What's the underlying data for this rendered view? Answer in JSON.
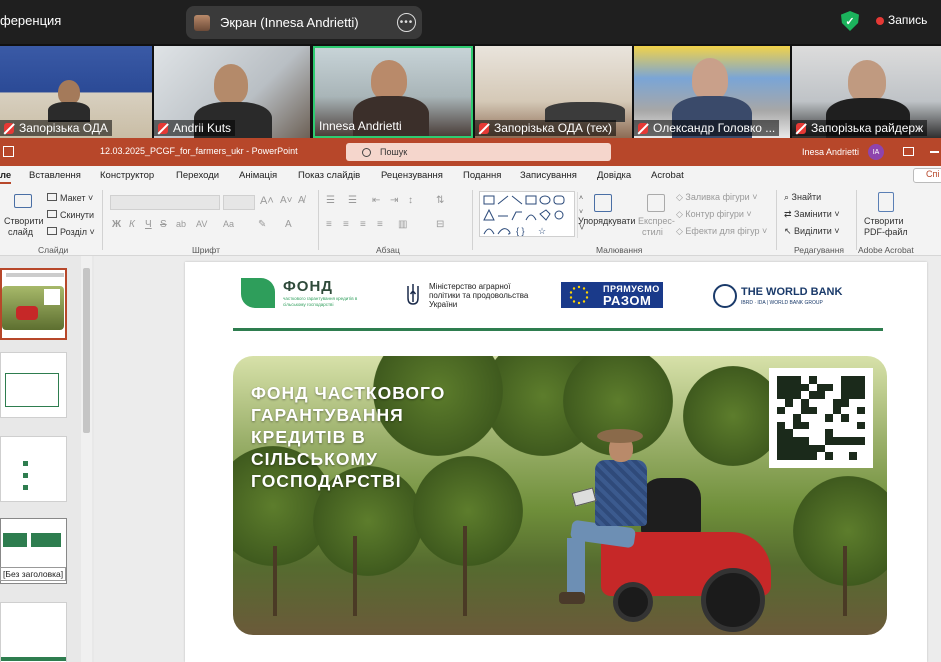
{
  "zoom": {
    "meeting_title": "ференция",
    "share_label": "Экран (Innesa Andrietti)",
    "record_label": "Запись"
  },
  "participants": [
    {
      "name": "Запорізька ОДА",
      "muted": true
    },
    {
      "name": "Andrii Kuts",
      "muted": true
    },
    {
      "name": "Innesa Andrietti",
      "muted": false
    },
    {
      "name": "Запорізька ОДА (тех)",
      "muted": true
    },
    {
      "name": "Олександр Головко ...",
      "muted": true
    },
    {
      "name": "Запорізька райдерж",
      "muted": true
    }
  ],
  "powerpoint": {
    "file_name": "12.03.2025_PCGF_for_farmers_ukr  -  PowerPoint",
    "search_placeholder": "Пошук",
    "user_name": "Inesa Andrietti",
    "user_initials": "IA",
    "tabs": [
      "ле",
      "Вставлення",
      "Конструктор",
      "Переходи",
      "Анімація",
      "Показ слайдів",
      "Рецензування",
      "Подання",
      "Записування",
      "Довідка",
      "Acrobat"
    ],
    "share_button": "Спі",
    "ribbon": {
      "new_slide": "Створити",
      "new_slide_2": "слайд",
      "layout": "Макет",
      "reset": "Скинути",
      "section": "Розділ",
      "group_slides": "Слайди",
      "group_font": "Шрифт",
      "group_paragraph": "Абзац",
      "arrange": "Упорядкувати",
      "quick_styles": "Експрес-",
      "quick_styles_2": "стилі",
      "shape_fill": "Заливка фігури",
      "shape_outline": "Контур фігури",
      "shape_effects": "Ефекти для фігур",
      "group_drawing": "Малювання",
      "find": "Знайти",
      "replace": "Замінити",
      "select": "Виділити",
      "group_editing": "Редагування",
      "create_pdf": "Створити",
      "create_pdf_2": "PDF-файл",
      "group_acrobat": "Adobe Acrobat"
    },
    "slides_tooltip": "[Без заголовка]"
  },
  "slide": {
    "logo_fond_title": "ФОНД",
    "logo_fond_sub": "часткового гарантування кредитів в сільському господарстві",
    "ministry_text": "Міністерство аграрної політики та продовольства України",
    "eu_line1": "ПРЯМУЄМО",
    "eu_line2": "РАЗОМ",
    "wb_title": "THE WORLD BANK",
    "wb_sub": "IBRD · IDA | WORLD BANK GROUP",
    "headline": "ФОНД ЧАСТКОВОГО ГАРАНТУВАННЯ КРЕДИТІВ В СІЛЬСЬКОМУ ГОСПОДАРСТВІ"
  },
  "colors": {
    "ppt_accent": "#b7472a",
    "fund_green": "#2e7d4f",
    "zoom_active": "#2ecc71",
    "record_red": "#e53935"
  }
}
